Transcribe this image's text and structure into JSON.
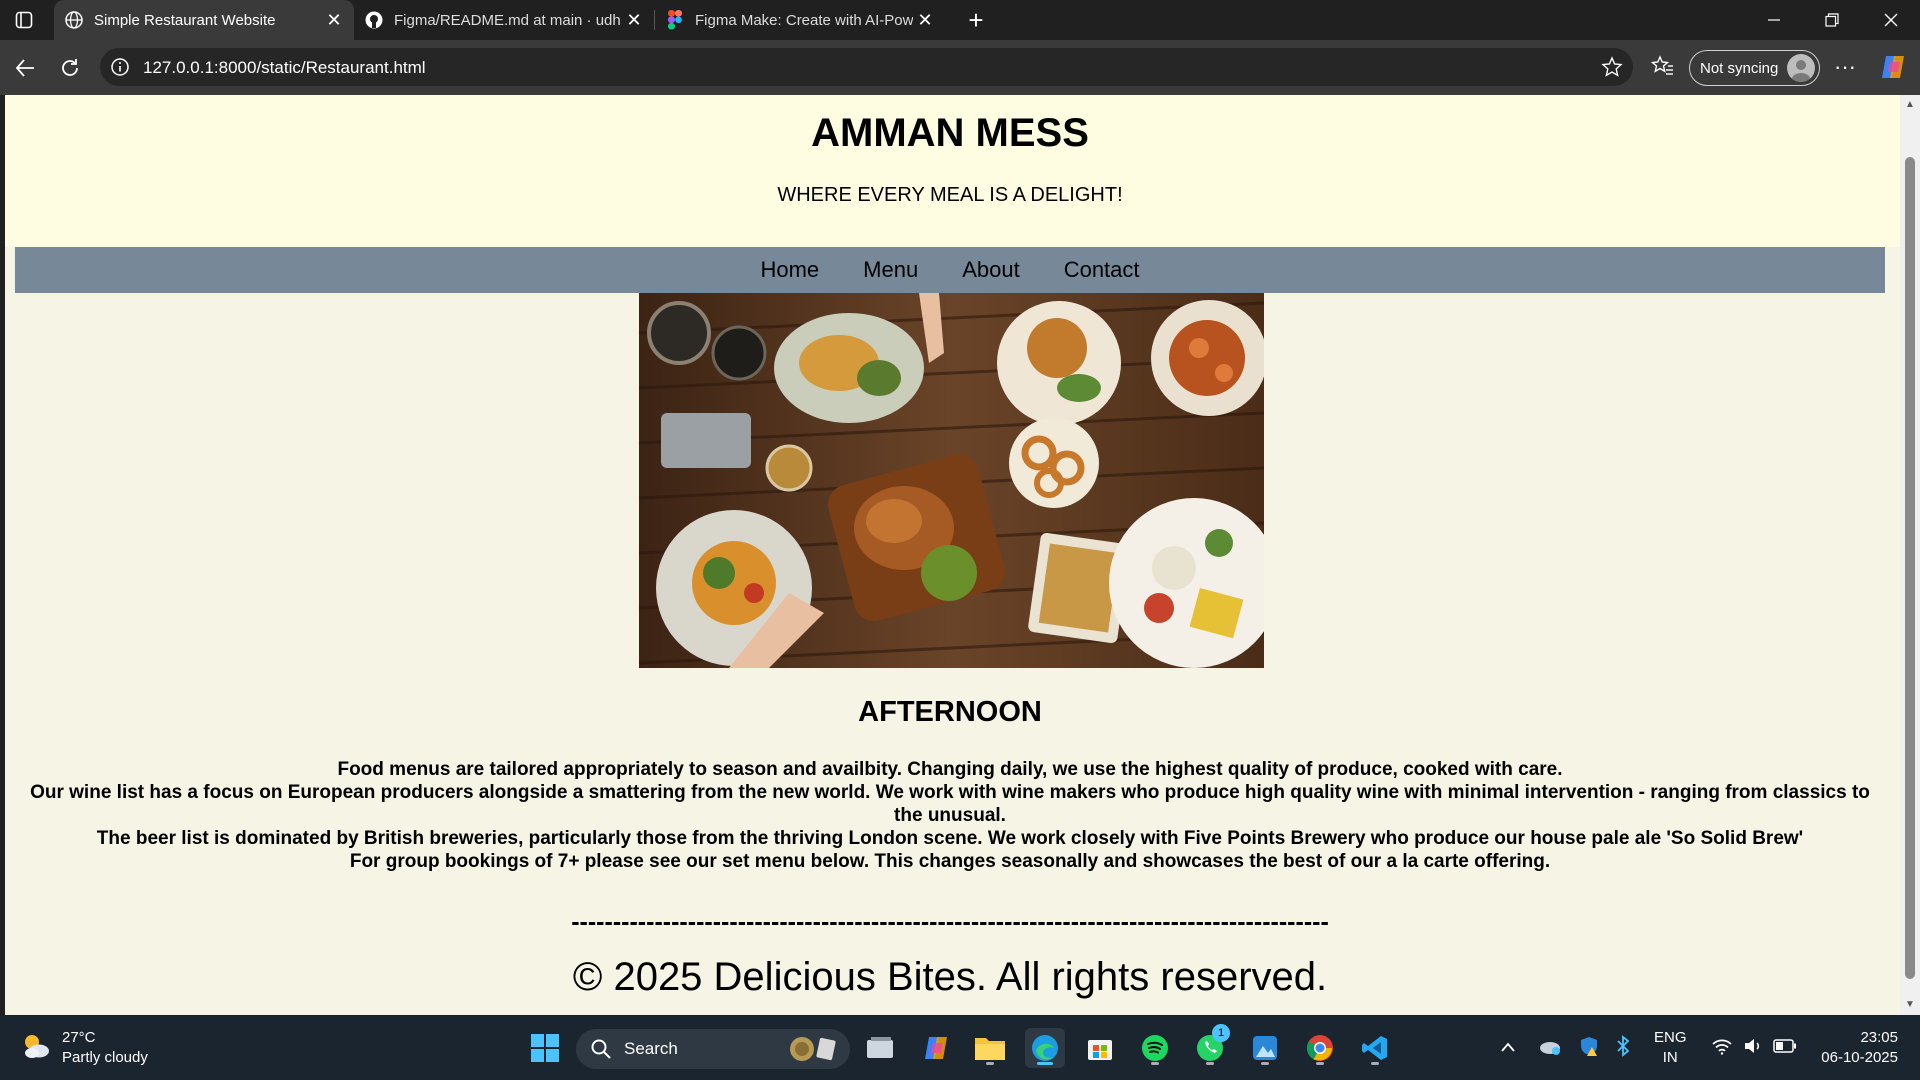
{
  "browser": {
    "tabs": [
      {
        "title": "Simple Restaurant Website",
        "active": true,
        "icon": "globe-icon"
      },
      {
        "title": "Figma/README.md at main · udh",
        "active": false,
        "icon": "github-icon"
      },
      {
        "title": "Figma Make: Create with AI-Powe",
        "active": false,
        "icon": "figma-icon"
      }
    ],
    "url": "127.0.0.1:8000/static/Restaurant.html",
    "sync_label": "Not syncing"
  },
  "site": {
    "title": "AMMAN MESS",
    "tagline": "WHERE EVERY MEAL IS A DELIGHT!",
    "nav": [
      "Home",
      "Menu",
      "About",
      "Contact"
    ],
    "section_title": "AFTERNOON",
    "paragraphs": [
      "Food menus are tailored appropriately to season and availbity. Changing daily, we use the highest quality of produce, cooked with care.",
      "Our wine list has a focus on European producers alongside a smattering from the new world. We work with wine makers who produce high quality wine with minimal intervention - ranging from classics to the unusual.",
      "The beer list is dominated by British breweries, particularly those from the thriving London scene. We work closely with Five Points Brewery who produce our house pale ale 'So Solid Brew'",
      "For group bookings of 7+ please see our set menu below. This changes seasonally and showcases the best of our a la carte offering."
    ],
    "divider": "-------------------------------------------------------------------------------------------",
    "footer": "© 2025 Delicious Bites. All rights reserved.",
    "colors": {
      "header_bg": "#fffde1",
      "nav_bg": "#778899",
      "page_bg": "#f6f4e4"
    }
  },
  "taskbar": {
    "weather_temp": "27°C",
    "weather_desc": "Partly cloudy",
    "search_placeholder": "Search",
    "whatsapp_badge": "1",
    "lang_top": "ENG",
    "lang_bottom": "IN",
    "time": "23:05",
    "date": "06-10-2025"
  }
}
